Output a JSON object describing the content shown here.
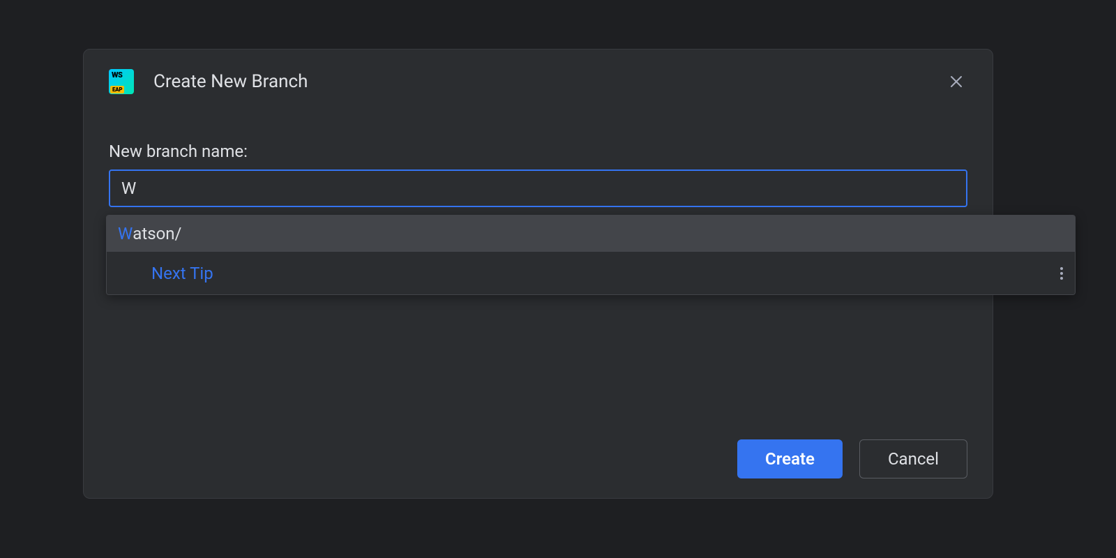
{
  "dialog": {
    "title": "Create New Branch",
    "app_icon": {
      "top_label": "WS",
      "bottom_label": "EAP"
    }
  },
  "form": {
    "field_label": "New branch name:",
    "input_value": "W"
  },
  "suggestions": {
    "items": [
      {
        "match": "W",
        "rest": "atson/"
      }
    ],
    "tip_label": "Next Tip"
  },
  "buttons": {
    "primary": "Create",
    "secondary": "Cancel"
  }
}
